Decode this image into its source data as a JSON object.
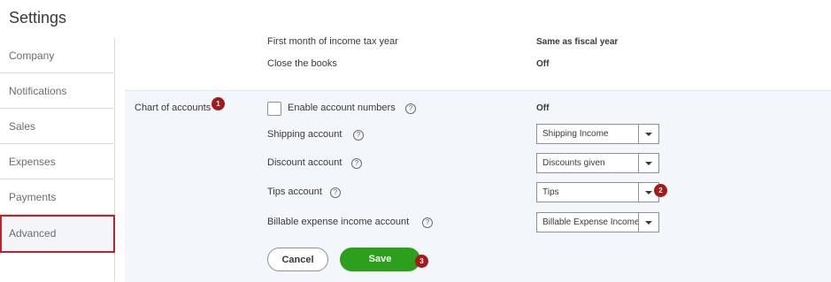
{
  "page": {
    "title": "Settings"
  },
  "sidebar": {
    "items": [
      {
        "label": "Company"
      },
      {
        "label": "Notifications"
      },
      {
        "label": "Sales"
      },
      {
        "label": "Expenses"
      },
      {
        "label": "Payments"
      },
      {
        "label": "Advanced",
        "active": true
      }
    ]
  },
  "accounting": {
    "first_month_label": "First month of income tax year",
    "first_month_value": "Same as fiscal year",
    "close_books_label": "Close the books",
    "close_books_value": "Off"
  },
  "chart_of_accounts": {
    "section_label": "Chart of accounts",
    "enable_numbers_label": "Enable account numbers",
    "enable_numbers_value": "Off",
    "shipping_label": "Shipping account",
    "shipping_value": "Shipping Income",
    "discount_label": "Discount account",
    "discount_value": "Discounts given",
    "tips_label": "Tips account",
    "tips_value": "Tips",
    "billable_label": "Billable expense income account",
    "billable_value": "Billable Expense Income",
    "help_glyph": "?"
  },
  "buttons": {
    "cancel": "Cancel",
    "save": "Save"
  },
  "badges": {
    "b1": "1",
    "b2": "2",
    "b3": "3"
  },
  "colors": {
    "save_green": "#2ca01c",
    "badge_red": "#a31a1a",
    "active_border": "#c0222b"
  }
}
